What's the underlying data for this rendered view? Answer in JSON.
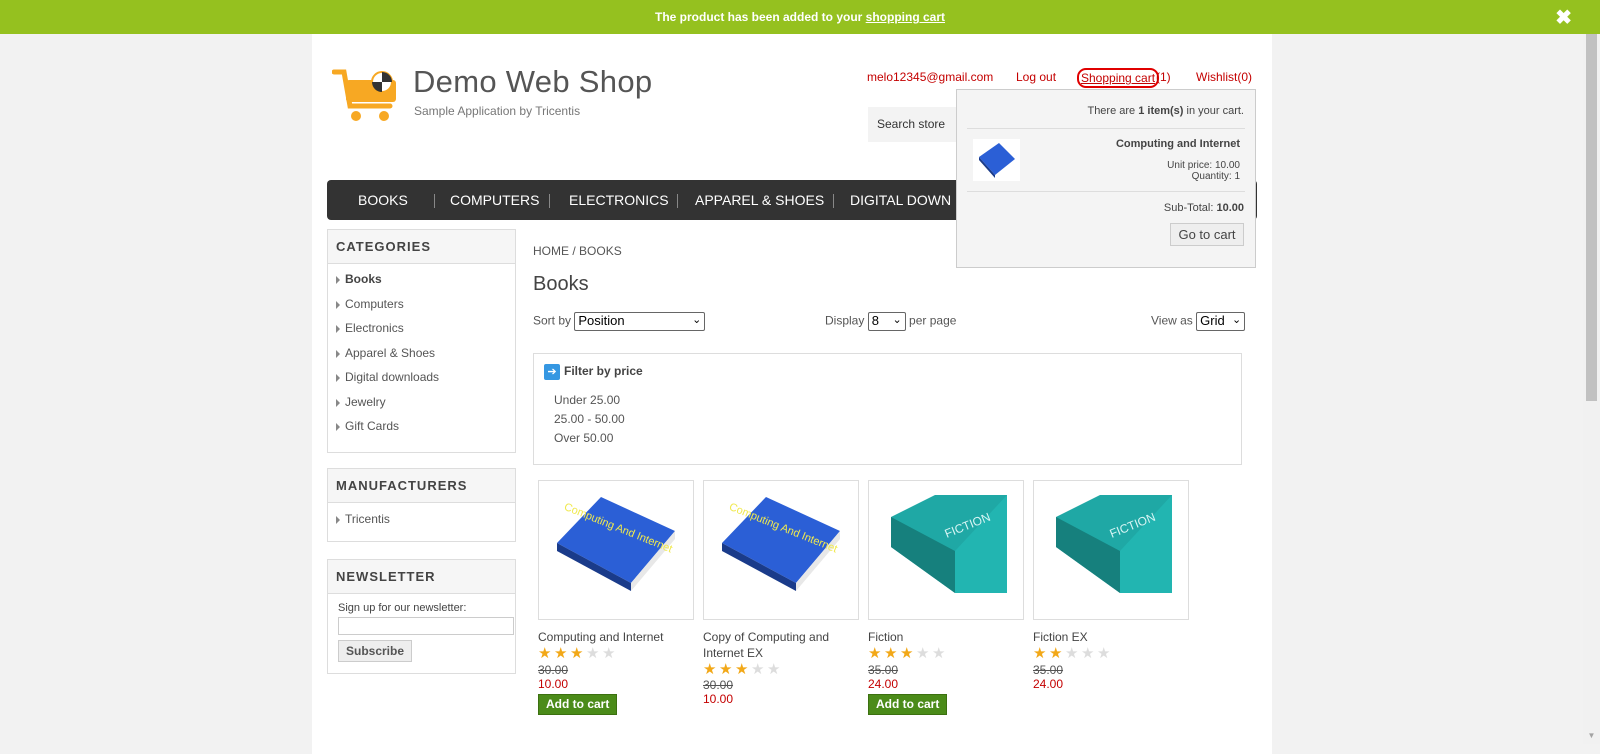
{
  "notification": {
    "text": "The product has been added to your ",
    "link": "shopping cart",
    "close": "✖"
  },
  "header": {
    "title": "Demo Web Shop",
    "subtitle": "Sample Application by Tricentis",
    "email": "melo12345@gmail.com",
    "logout": "Log out",
    "cart": "Shopping cart",
    "cart_count": "(1)",
    "wishlist": "Wishlist(0)",
    "search_placeholder": "Search store"
  },
  "cart_flyout": {
    "count_prefix": "There are ",
    "count_bold": "1 item(s)",
    "count_suffix": " in your cart.",
    "item_name": "Computing and Internet",
    "unit_price": "Unit price: 10.00",
    "quantity": "Quantity: 1",
    "subtotal_label": "Sub-Total: ",
    "subtotal_value": "10.00",
    "go_to_cart": "Go to cart"
  },
  "menu": [
    "BOOKS",
    "COMPUTERS",
    "ELECTRONICS",
    "APPAREL & SHOES",
    "DIGITAL DOWN"
  ],
  "sidebar": {
    "categories_title": "CATEGORIES",
    "categories": [
      "Books",
      "Computers",
      "Electronics",
      "Apparel & Shoes",
      "Digital downloads",
      "Jewelry",
      "Gift Cards"
    ],
    "manufacturers_title": "MANUFACTURERS",
    "manufacturers": [
      "Tricentis"
    ],
    "newsletter_title": "NEWSLETTER",
    "newsletter_label": "Sign up for our newsletter:",
    "subscribe": "Subscribe"
  },
  "main": {
    "breadcrumb_home": "HOME",
    "breadcrumb_sep": "/",
    "breadcrumb_current": "BOOKS",
    "title": "Books",
    "sort_label": "Sort by",
    "sort_value": "Position",
    "display_label": "Display",
    "display_value": "8",
    "per_page": "per page",
    "view_label": "View as",
    "view_value": "Grid",
    "filter_title": "Filter by price",
    "filters": [
      "Under 25.00",
      "25.00 - 50.00",
      "Over 50.00"
    ]
  },
  "products": [
    {
      "name": "Computing and Internet",
      "rating": 2.5,
      "old_price": "30.00",
      "price": "10.00",
      "button": "Add to cart",
      "cover": "Computing And Internet",
      "color": "#2b5fd6"
    },
    {
      "name": "Copy of Computing and Internet EX",
      "rating": 2.5,
      "old_price": "30.00",
      "price": "10.00",
      "button": "",
      "cover": "Computing And Internet",
      "color": "#2b5fd6"
    },
    {
      "name": "Fiction",
      "rating": 2.5,
      "old_price": "35.00",
      "price": "24.00",
      "button": "Add to cart",
      "cover": "FICTION",
      "color": "#1fa8a5"
    },
    {
      "name": "Fiction EX",
      "rating": 2,
      "old_price": "35.00",
      "price": "24.00",
      "button": "",
      "cover": "FICTION",
      "color": "#1fa8a5"
    }
  ],
  "colors": {
    "accent": "#95c11f",
    "link": "#c40000",
    "menu": "#333333",
    "button": "#4b8b19"
  }
}
